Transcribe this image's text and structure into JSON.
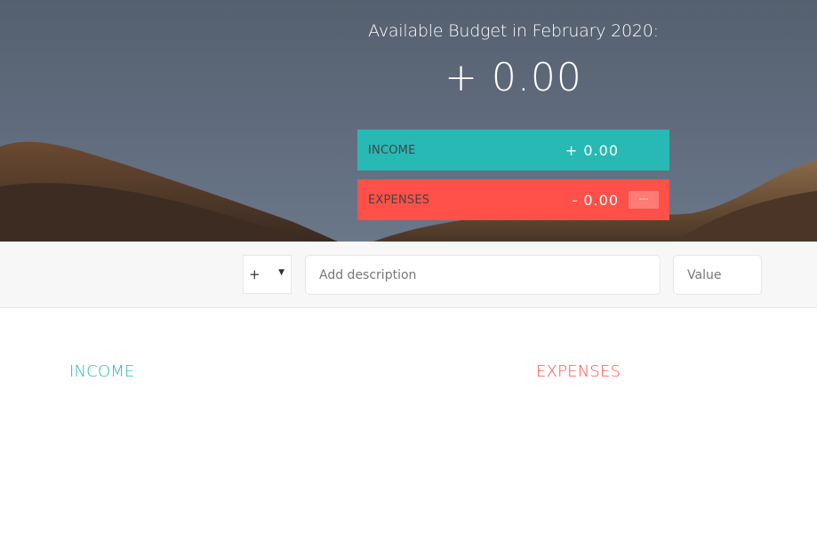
{
  "header": {
    "title": "Available Budget in February 2020:",
    "budget_value": "+ 0.00"
  },
  "summary": {
    "income": {
      "label": "INCOME",
      "value": "+ 0.00"
    },
    "expenses": {
      "label": "EXPENSES",
      "value": "- 0.00",
      "percentage": "---"
    }
  },
  "add_form": {
    "type_value": "+",
    "description_placeholder": "Add description",
    "value_placeholder": "Value"
  },
  "lists": {
    "income_title": "INCOME",
    "expenses_title": "EXPENSES"
  },
  "colors": {
    "income": "#28b9b5",
    "expenses": "#ff5049",
    "background": "#ffffff",
    "bar": "#f7f7f7"
  }
}
